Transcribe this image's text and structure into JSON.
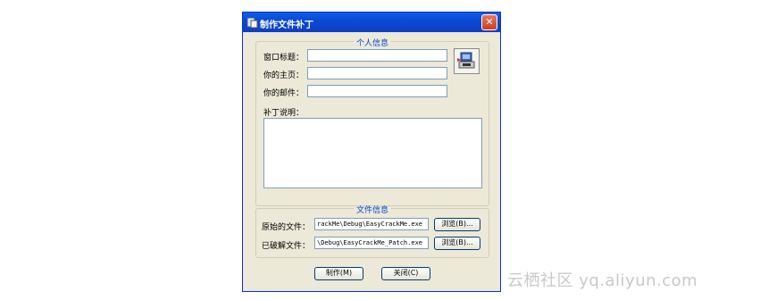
{
  "window": {
    "title": "制作文件补丁",
    "close": "✕"
  },
  "personal": {
    "group_title": "个人信息",
    "window_title_label": "窗口标题：",
    "homepage_label": "你的主页：",
    "email_label": "你的邮件：",
    "window_title_value": "",
    "homepage_value": "",
    "email_value": "",
    "notes_label": "补丁说明：",
    "notes_value": ""
  },
  "files": {
    "group_title": "文件信息",
    "original_label": "原始的文件：",
    "original_value": "rackMe\\Debug\\EasyCrackMe.exe",
    "cracked_label": "已破解文件：",
    "cracked_value": "\\Debug\\EasyCrackMe_Patch.exe",
    "browse1": "浏览(B)...",
    "browse2": "浏览(B)..."
  },
  "footer": {
    "make": "制作(M)",
    "close": "关闭(C)"
  },
  "watermark": "云栖社区 yq.aliyun.com"
}
